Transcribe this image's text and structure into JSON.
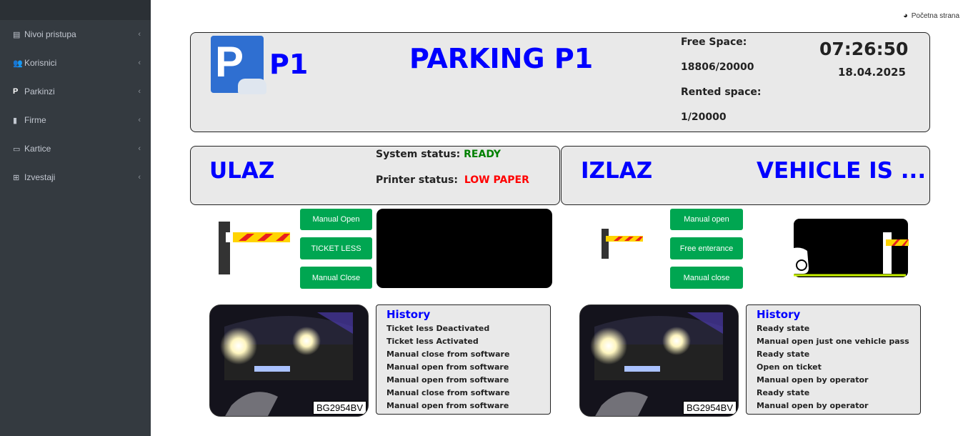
{
  "sidebar": {
    "items": [
      {
        "icon": "id-card-icon",
        "label": "Nivoi pristupa"
      },
      {
        "icon": "users-icon",
        "label": "Korisnici"
      },
      {
        "icon": "parking-icon",
        "label": "Parkinzi"
      },
      {
        "icon": "briefcase-icon",
        "label": "Firme"
      },
      {
        "icon": "credit-card-icon",
        "label": "Kartice"
      },
      {
        "icon": "table-icon",
        "label": "Izvestaji"
      }
    ]
  },
  "header": {
    "home_link": "Početna strana",
    "parking_code": "P1",
    "parking_title": "PARKING P1",
    "free_space_label": "Free Space:",
    "free_space_value": "18806/20000",
    "rented_space_label": "Rented space:",
    "rented_space_value": "1/20000",
    "time": "07:26:50",
    "date": "18.04.2025"
  },
  "entrance": {
    "title": "ULAZ",
    "system_status_label": "System status:",
    "system_status_value": "READY",
    "printer_status_label": "Printer status:",
    "printer_status_value": "LOW PAPER",
    "buttons": {
      "manual_open": "Manual Open",
      "ticket_less": "TICKET LESS",
      "manual_close": "Manual Close"
    },
    "plate": "BG2954BV",
    "history_title": "History",
    "history": [
      "Ticket less Deactivated",
      "Ticket less Activated",
      "Manual close from software",
      "Manual open from software",
      "Manual open from software",
      "Manual close from software",
      "Manual open from software"
    ]
  },
  "exit": {
    "title": "IZLAZ",
    "vehicle_status": "VEHICLE IS ...",
    "buttons": {
      "manual_open": "Manual open",
      "free_entrance": "Free enterance",
      "manual_close": "Manual close"
    },
    "plate": "BG2954BV",
    "history_title": "History",
    "history": [
      "Ready state",
      "Manual open just one vehicle pass",
      "Ready state",
      "Open on ticket",
      "Manual open by operator",
      "Ready state",
      "Manual open by operator"
    ]
  },
  "colors": {
    "accent_blue": "#0000ff",
    "status_ready": "#008000",
    "status_warning": "#ff0000",
    "button_green": "#00a651",
    "sidebar_bg": "#343a40"
  }
}
